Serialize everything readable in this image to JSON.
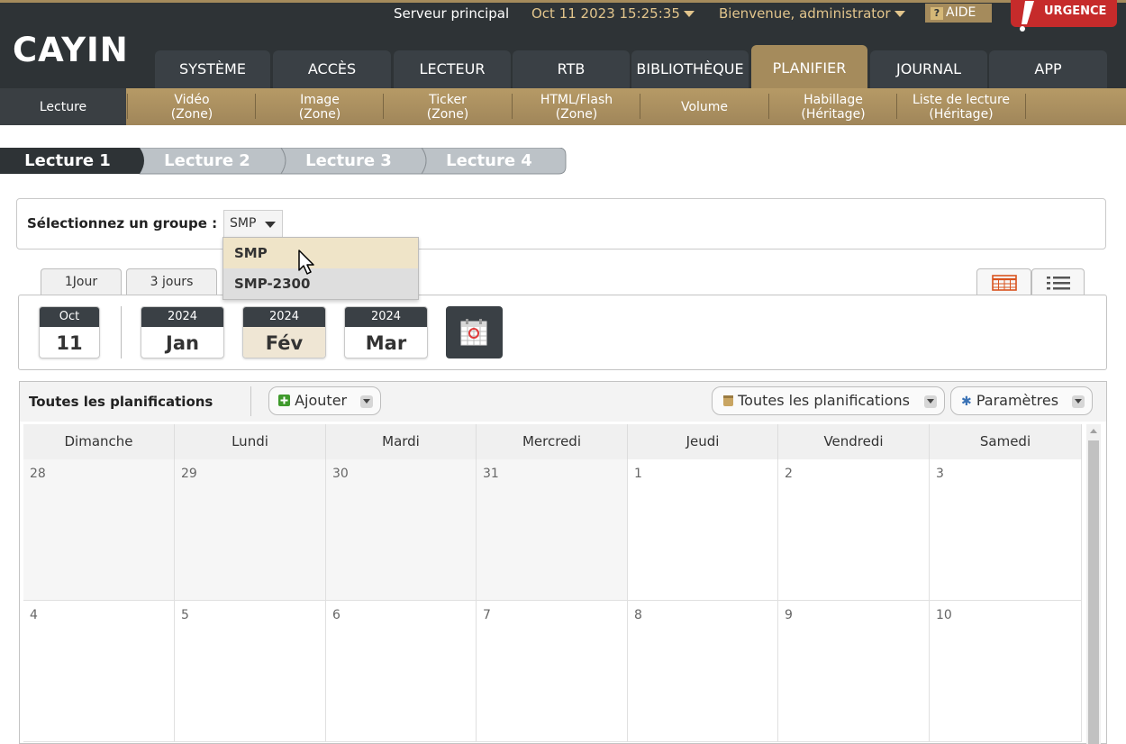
{
  "header": {
    "logo": "CAYIN",
    "server": "Serveur principal",
    "datetime": "Oct 11 2023 15:25:35",
    "welcome": "Bienvenue, administrator",
    "help": "AIDE",
    "help_mark": "?",
    "urgent": "URGENCE",
    "accent_color": "#a58b5c",
    "urgent_color": "#c62b2b"
  },
  "nav": {
    "tabs": [
      "SYSTÈME",
      "ACCÈS",
      "LECTEUR",
      "RTB",
      "BIBLIOTHÈQUE",
      "PLANIFIER",
      "JOURNAL",
      "APP"
    ],
    "active": "PLANIFIER"
  },
  "submenu": {
    "items": [
      {
        "l1": "Lecture",
        "l2": ""
      },
      {
        "l1": "Vidéo",
        "l2": "(Zone)"
      },
      {
        "l1": "Image",
        "l2": "(Zone)"
      },
      {
        "l1": "Ticker",
        "l2": "(Zone)"
      },
      {
        "l1": "HTML/Flash",
        "l2": "(Zone)"
      },
      {
        "l1": "Volume",
        "l2": ""
      },
      {
        "l1": "Habillage",
        "l2": "(Héritage)"
      },
      {
        "l1": "Liste de lecture",
        "l2": "(Héritage)"
      }
    ],
    "active": "Lecture"
  },
  "lectures": [
    "Lecture 1",
    "Lecture 2",
    "Lecture 3",
    "Lecture 4"
  ],
  "group": {
    "label": "Sélectionnez un groupe :",
    "selected": "SMP",
    "options": [
      "SMP",
      "SMP-2300"
    ],
    "highlighted": "SMP"
  },
  "view_tabs": {
    "day": "1Jour",
    "three_days": "3 jours",
    "calendar_icon": "calendar-grid-icon",
    "list_icon": "list-icon"
  },
  "date_cards": [
    {
      "top": "Oct",
      "bottom": "11",
      "selected": false
    },
    {
      "top": "2024",
      "bottom": "Jan",
      "selected": false
    },
    {
      "top": "2024",
      "bottom": "Fév",
      "selected": true
    },
    {
      "top": "2024",
      "bottom": "Mar",
      "selected": false
    }
  ],
  "schedule": {
    "title": "Toutes les planifications",
    "add": "Ajouter",
    "filter": "Toutes les planifications",
    "settings": "Paramètres",
    "weekdays": [
      "Dimanche",
      "Lundi",
      "Mardi",
      "Mercredi",
      "Jeudi",
      "Vendredi",
      "Samedi"
    ],
    "weeks": [
      [
        {
          "day": "28",
          "prev": true
        },
        {
          "day": "29",
          "prev": true
        },
        {
          "day": "30",
          "prev": true
        },
        {
          "day": "31",
          "prev": true
        },
        {
          "day": "1",
          "prev": false
        },
        {
          "day": "2",
          "prev": false
        },
        {
          "day": "3",
          "prev": false
        }
      ],
      [
        {
          "day": "4",
          "prev": false
        },
        {
          "day": "5",
          "prev": false
        },
        {
          "day": "6",
          "prev": false
        },
        {
          "day": "7",
          "prev": false
        },
        {
          "day": "8",
          "prev": false
        },
        {
          "day": "9",
          "prev": false
        },
        {
          "day": "10",
          "prev": false
        }
      ]
    ]
  }
}
